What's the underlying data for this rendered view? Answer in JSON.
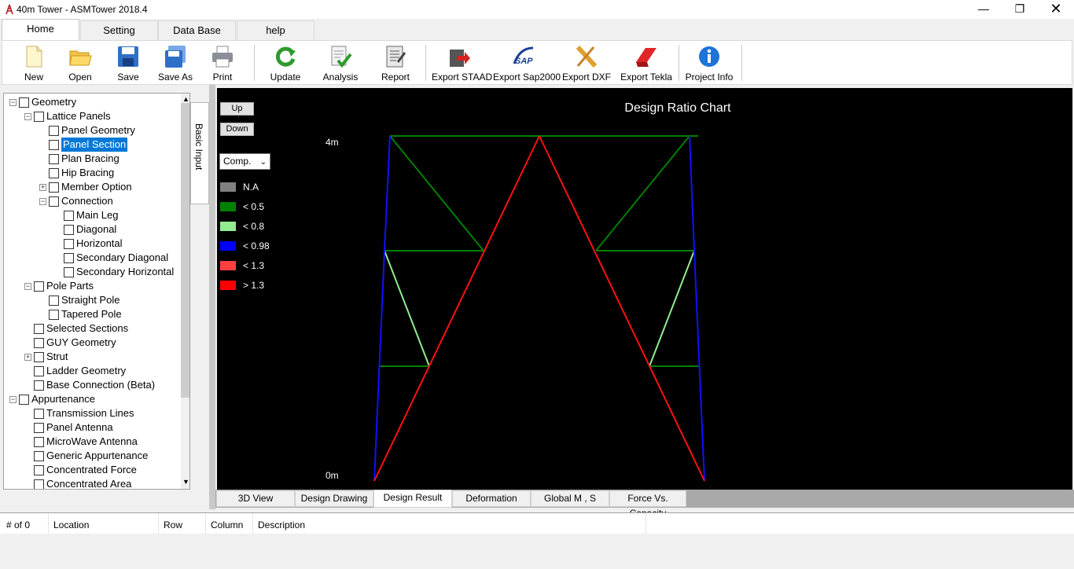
{
  "window": {
    "title": "40m Tower - ASMTower 2018.4"
  },
  "tabs": [
    "Home",
    "Setting",
    "Data Base",
    "help"
  ],
  "toolbar": [
    "New",
    "Open",
    "Save",
    "Save As",
    "Print",
    "Update",
    "Analysis",
    "Report",
    "Export STAAD",
    "Export Sap2000",
    "Export DXF",
    "Export Tekla",
    "Project Info"
  ],
  "tree": [
    {
      "label": "Geometry",
      "level": 0,
      "expander": "-"
    },
    {
      "label": "Lattice Panels",
      "level": 1,
      "expander": "-"
    },
    {
      "label": "Panel Geometry",
      "level": 2
    },
    {
      "label": "Panel Section",
      "level": 2,
      "selected": true
    },
    {
      "label": "Plan Bracing",
      "level": 2
    },
    {
      "label": "Hip Bracing",
      "level": 2
    },
    {
      "label": "Member Option",
      "level": 2,
      "expander": "+"
    },
    {
      "label": "Connection",
      "level": 2,
      "expander": "-"
    },
    {
      "label": "Main Leg",
      "level": 3
    },
    {
      "label": "Diagonal",
      "level": 3
    },
    {
      "label": "Horizontal",
      "level": 3
    },
    {
      "label": "Secondary Diagonal",
      "level": 3
    },
    {
      "label": "Secondary Horizontal",
      "level": 3
    },
    {
      "label": "Pole Parts",
      "level": 1,
      "expander": "-"
    },
    {
      "label": "Straight Pole",
      "level": 2
    },
    {
      "label": "Tapered Pole",
      "level": 2
    },
    {
      "label": "Selected Sections",
      "level": 1
    },
    {
      "label": "GUY Geometry",
      "level": 1
    },
    {
      "label": "Strut",
      "level": 1,
      "expander": "+"
    },
    {
      "label": "Ladder Geometry",
      "level": 1
    },
    {
      "label": "Base Connection (Beta)",
      "level": 1
    },
    {
      "label": "Appurtenance",
      "level": 0,
      "expander": "-"
    },
    {
      "label": "Transmission Lines",
      "level": 1
    },
    {
      "label": "Panel Antenna",
      "level": 1
    },
    {
      "label": "MicroWave Antenna",
      "level": 1
    },
    {
      "label": "Generic Appurtenance",
      "level": 1
    },
    {
      "label": "Concentrated Force",
      "level": 1
    },
    {
      "label": "Concentrated Area",
      "level": 1
    }
  ],
  "side_tab": "Basic Input",
  "chart": {
    "title": "Design Ratio Chart",
    "up": "Up",
    "down": "Down",
    "mode": "Comp.",
    "y_top": "4m",
    "y_bottom": "0m",
    "legend": [
      {
        "label": "N.A",
        "color": "#808080"
      },
      {
        "label": "< 0.5",
        "color": "#008000"
      },
      {
        "label": "< 0.8",
        "color": "#90ee90"
      },
      {
        "label": "< 0.98",
        "color": "#0000ff"
      },
      {
        "label": "< 1.3",
        "color": "#ff4040"
      },
      {
        "label": "> 1.3",
        "color": "#ff0000"
      }
    ]
  },
  "result_tabs": [
    "3D View",
    "Design Drawing",
    "Design Result",
    "Deformation",
    "Global M , S",
    "Force Vs. Capacity"
  ],
  "active_result_tab": "Design Result",
  "messages": {
    "columns": [
      "# of 0",
      "Location",
      "Row",
      "Column",
      "Description"
    ]
  }
}
